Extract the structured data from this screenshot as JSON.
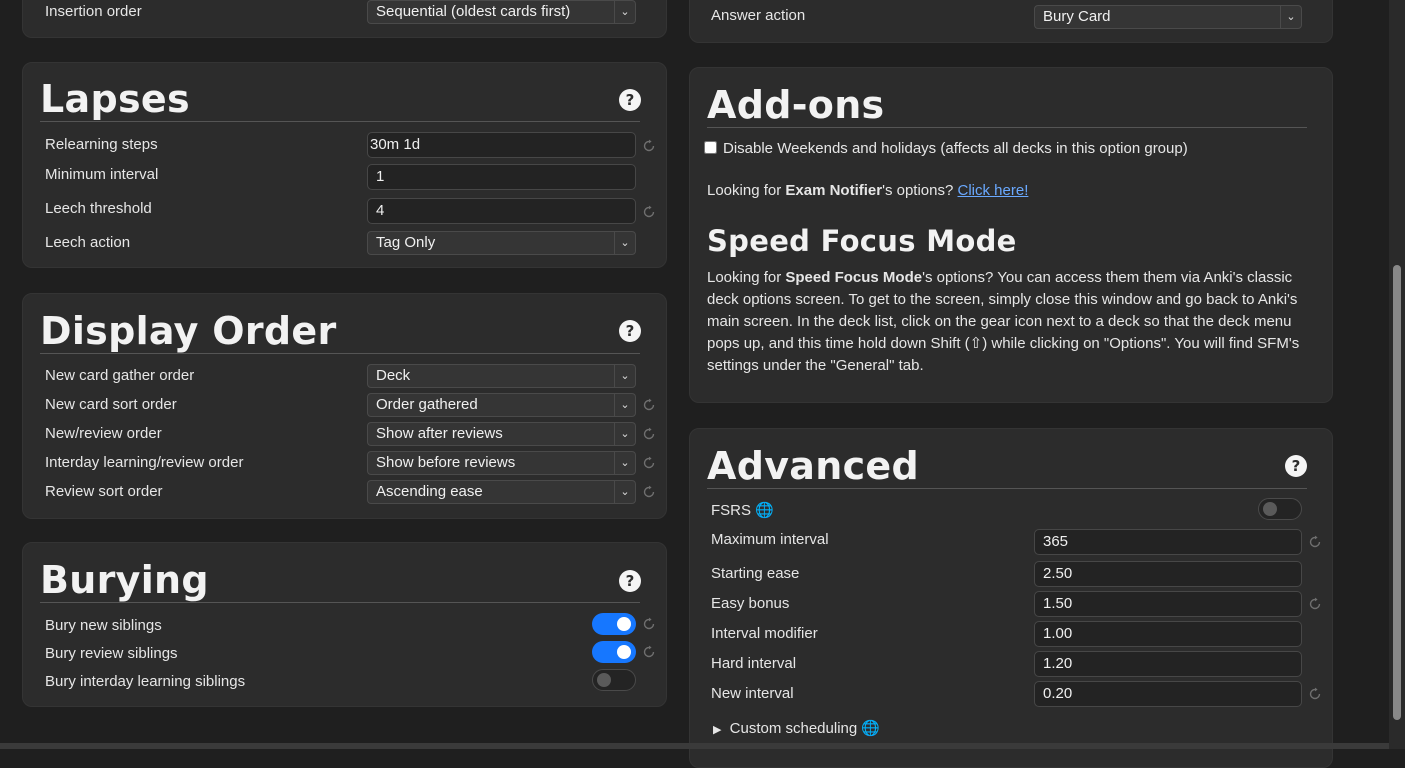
{
  "new_cards_fragment": {
    "insertion_order_label": "Insertion order",
    "insertion_order_value": "Sequential (oldest cards first)"
  },
  "burying_fragment": {
    "answer_action_label": "Answer action",
    "answer_action_value": "Bury Card"
  },
  "lapses": {
    "title": "Lapses",
    "help": "?",
    "relearning_steps_label": "Relearning steps",
    "relearning_steps_value": "30m 1d",
    "minimum_interval_label": "Minimum interval",
    "minimum_interval_value": "1",
    "leech_threshold_label": "Leech threshold",
    "leech_threshold_value": "4",
    "leech_action_label": "Leech action",
    "leech_action_value": "Tag Only"
  },
  "display_order": {
    "title": "Display Order",
    "help": "?",
    "rows": [
      {
        "label": "New card gather order",
        "value": "Deck"
      },
      {
        "label": "New card sort order",
        "value": "Order gathered"
      },
      {
        "label": "New/review order",
        "value": "Show after reviews"
      },
      {
        "label": "Interday learning/review order",
        "value": "Show before reviews"
      },
      {
        "label": "Review sort order",
        "value": "Ascending ease"
      }
    ]
  },
  "burying": {
    "title": "Burying",
    "help": "?",
    "rows": [
      {
        "label": "Bury new siblings",
        "on": true
      },
      {
        "label": "Bury review siblings",
        "on": true
      },
      {
        "label": "Bury interday learning siblings",
        "on": false
      }
    ]
  },
  "addons": {
    "title": "Add-ons",
    "disable_checkbox_label": "Disable Weekends and holidays (affects all decks in this option group)",
    "exam_prefix": "Looking for ",
    "exam_bold": "Exam Notifier",
    "exam_suffix": "'s options? ",
    "exam_link": "Click here!",
    "sfm_title": "Speed Focus Mode",
    "sfm_prefix": "Looking for ",
    "sfm_bold": "Speed Focus Mode",
    "sfm_text": "'s options? You can access them them via Anki's classic deck options screen. To get to the screen, simply close this window and go back to Anki's main screen. In the deck list, click on the gear icon next to a deck so that the deck menu pops up, and this time hold down Shift (⇧) while clicking on \"Options\". You will find SFM's settings under the \"General\" tab."
  },
  "advanced": {
    "title": "Advanced",
    "help": "?",
    "fsrs_label": "FSRS",
    "fsrs_on": false,
    "maximum_interval_label": "Maximum interval",
    "maximum_interval_value": "365",
    "starting_ease_label": "Starting ease",
    "starting_ease_value": "2.50",
    "easy_bonus_label": "Easy bonus",
    "easy_bonus_value": "1.50",
    "interval_modifier_label": "Interval modifier",
    "interval_modifier_value": "1.00",
    "hard_interval_label": "Hard interval",
    "hard_interval_value": "1.20",
    "new_interval_label": "New interval",
    "new_interval_value": "0.20",
    "custom_scheduling_label": "Custom scheduling",
    "disclosure_arrow": "▶"
  },
  "colors": {
    "accent": "#1677ff",
    "link": "#6aa9ff",
    "card_bg": "#2c2c2c",
    "page_bg": "#1f1f1f"
  }
}
